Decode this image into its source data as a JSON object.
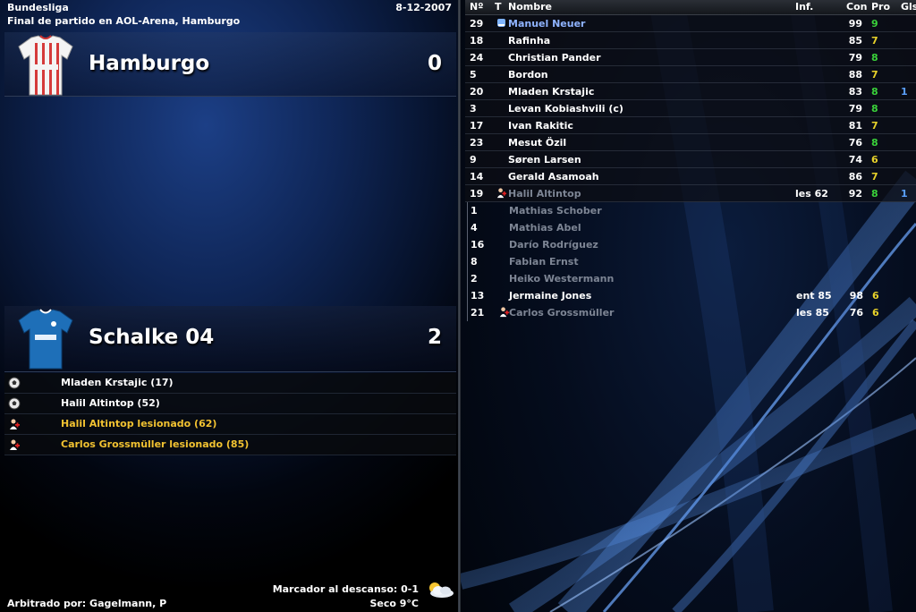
{
  "header": {
    "league": "Bundesliga",
    "date": "8-12-2007",
    "subtitle": "Final de partido en AOL-Arena, Hamburgo"
  },
  "home": {
    "name": "Hamburgo",
    "score": "0",
    "jersey_colors": {
      "base": "#f4f4f4",
      "stripe": "#d53a3a"
    }
  },
  "away": {
    "name": "Schalke 04",
    "score": "2",
    "jersey_colors": {
      "base": "#1e6fb8",
      "trim": "#ffffff"
    }
  },
  "events": [
    {
      "type": "goal",
      "icon": "ball-icon",
      "text": "Mladen Krstajic (17)"
    },
    {
      "type": "goal",
      "icon": "ball-icon",
      "text": "Halil Altintop (52)"
    },
    {
      "type": "injury",
      "icon": "injury-icon",
      "text": "Halil Altintop lesionado (62)"
    },
    {
      "type": "injury",
      "icon": "injury-icon",
      "text": "Carlos Grossmüller lesionado (85)"
    }
  ],
  "footer": {
    "halftime": "Marcador al descanso: 0-1",
    "weather": "Seco 9°C",
    "weather_icon": "sun-cloud-icon",
    "referee": "Arbitrado por: Gagelmann, P"
  },
  "table": {
    "headers": {
      "num": "Nº",
      "t": "T",
      "name": "Nombre",
      "inf": "Inf.",
      "con": "Con",
      "pro": "Pro",
      "gls": "Gls"
    },
    "starters": [
      {
        "num": "29",
        "icon": "glove-icon",
        "name": "Manuel Neuer",
        "inf": "",
        "con": "99",
        "pro": "9",
        "gls": "",
        "highlight": true
      },
      {
        "num": "18",
        "icon": "",
        "name": "Rafinha",
        "inf": "",
        "con": "85",
        "pro": "7",
        "gls": ""
      },
      {
        "num": "24",
        "icon": "",
        "name": "Christian Pander",
        "inf": "",
        "con": "79",
        "pro": "8",
        "gls": ""
      },
      {
        "num": "5",
        "icon": "",
        "name": "Bordon",
        "inf": "",
        "con": "88",
        "pro": "7",
        "gls": ""
      },
      {
        "num": "20",
        "icon": "",
        "name": "Mladen Krstajic",
        "inf": "",
        "con": "83",
        "pro": "8",
        "gls": "1"
      },
      {
        "num": "3",
        "icon": "",
        "name": "Levan Kobiashvili (c)",
        "inf": "",
        "con": "79",
        "pro": "8",
        "gls": ""
      },
      {
        "num": "17",
        "icon": "",
        "name": "Ivan Rakitic",
        "inf": "",
        "con": "81",
        "pro": "7",
        "gls": ""
      },
      {
        "num": "23",
        "icon": "",
        "name": "Mesut Özil",
        "inf": "",
        "con": "76",
        "pro": "8",
        "gls": ""
      },
      {
        "num": "9",
        "icon": "",
        "name": "Søren Larsen",
        "inf": "",
        "con": "74",
        "pro": "6",
        "gls": ""
      },
      {
        "num": "14",
        "icon": "",
        "name": "Gerald Asamoah",
        "inf": "",
        "con": "86",
        "pro": "7",
        "gls": ""
      },
      {
        "num": "19",
        "icon": "injury-icon",
        "name": "Halil Altintop",
        "inf": "les 62",
        "con": "92",
        "pro": "8",
        "gls": "1",
        "dim": true
      }
    ],
    "bench": [
      {
        "num": "1",
        "icon": "",
        "name": "Mathias Schober",
        "inf": "",
        "con": "",
        "pro": "",
        "dim": true
      },
      {
        "num": "4",
        "icon": "",
        "name": "Mathias Abel",
        "inf": "",
        "con": "",
        "pro": "",
        "dim": true
      },
      {
        "num": "16",
        "icon": "",
        "name": "Darío Rodríguez",
        "inf": "",
        "con": "",
        "pro": "",
        "dim": true
      },
      {
        "num": "8",
        "icon": "",
        "name": "Fabian Ernst",
        "inf": "",
        "con": "",
        "pro": "",
        "dim": true
      },
      {
        "num": "2",
        "icon": "",
        "name": "Heiko Westermann",
        "inf": "",
        "con": "",
        "pro": "",
        "dim": true
      },
      {
        "num": "13",
        "icon": "",
        "name": "Jermaine Jones",
        "inf": "ent 85",
        "con": "98",
        "pro": "6"
      },
      {
        "num": "21",
        "icon": "injury-icon",
        "name": "Carlos Grossmüller",
        "inf": "les 85",
        "con": "76",
        "pro": "6",
        "dim": true
      }
    ]
  },
  "colors": {
    "pro_high": "#3ad13a",
    "pro_low": "#e8d22a",
    "injury_text": "#f2c231",
    "highlight_name": "#8fb3ff"
  }
}
